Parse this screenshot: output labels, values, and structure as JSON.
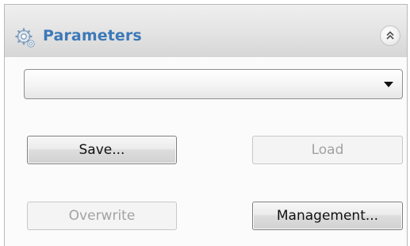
{
  "panel": {
    "title": "Parameters",
    "header_icon": "gear-icon",
    "collapse_icon": "double-chevron-up-icon"
  },
  "combo": {
    "value": "",
    "arrow_icon": "chevron-down-icon"
  },
  "buttons": {
    "save": {
      "label": "Save...",
      "enabled": true
    },
    "load": {
      "label": "Load",
      "enabled": false
    },
    "overwrite": {
      "label": "Overwrite",
      "enabled": false
    },
    "management": {
      "label": "Management...",
      "enabled": true
    }
  },
  "colors": {
    "title": "#3c79b8",
    "disabled_text": "#a2a2a2"
  }
}
